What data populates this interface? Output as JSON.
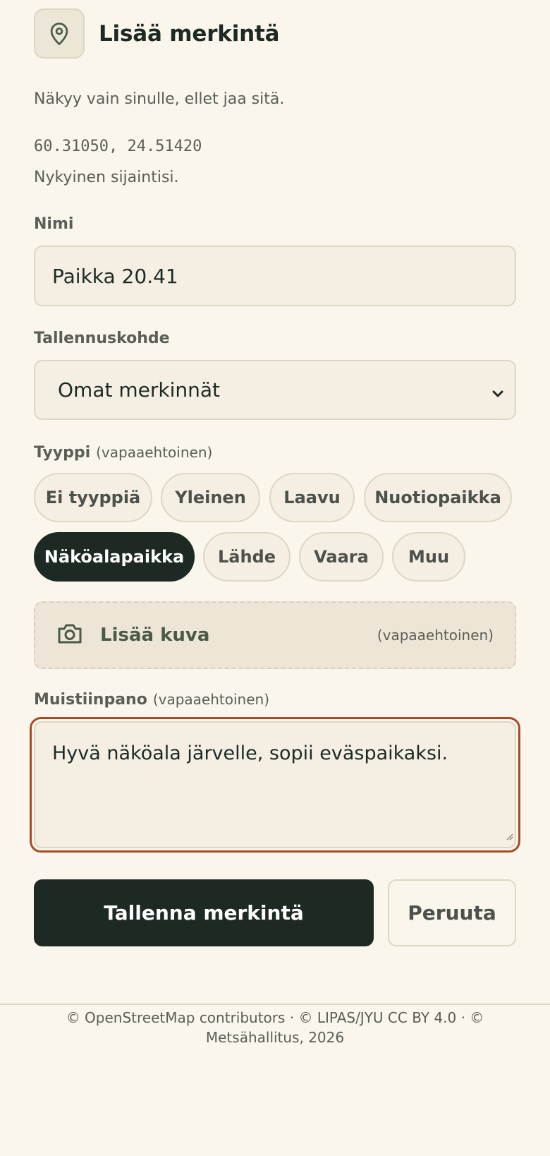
{
  "header": {
    "title": "Lisää merkintä",
    "icon": "map-pin-icon"
  },
  "visibility_hint": "Näkyy vain sinulle, ellet jaa sitä.",
  "location": {
    "coordinates": "60.31050, 24.51420",
    "note": "Nykyinen sijaintisi."
  },
  "name_field": {
    "label": "Nimi",
    "value": "Paikka 20.41"
  },
  "destination_field": {
    "label": "Tallennuskohde",
    "selected": "Omat merkinnät",
    "icon": "chevron-down-icon"
  },
  "type_field": {
    "label": "Tyyppi",
    "optional_label": "(vapaaehtoinen)",
    "options": [
      "Ei tyyppiä",
      "Yleinen",
      "Laavu",
      "Nuotiopaikka",
      "Näköalapaikka",
      "Lähde",
      "Vaara",
      "Muu"
    ],
    "selected": "Näköalapaikka"
  },
  "photo": {
    "label": "Lisää kuva",
    "optional_label": "(vapaaehtoinen)",
    "icon": "camera-icon"
  },
  "note_field": {
    "label": "Muistiinpano",
    "optional_label": "(vapaaehtoinen)",
    "value": "Hyvä näköala järvelle, sopii eväspaikaksi."
  },
  "actions": {
    "save_label": "Tallenna merkintä",
    "cancel_label": "Peruuta"
  },
  "footer": {
    "attribution": "© OpenStreetMap contributors · © LIPAS/JYU CC BY 4.0 · © Metsähallitus, 2026"
  },
  "colors": {
    "background": "#faf6ec",
    "primary": "#1d2a24",
    "focus_ring": "#a84a26",
    "field_bg": "#f4eee3"
  }
}
